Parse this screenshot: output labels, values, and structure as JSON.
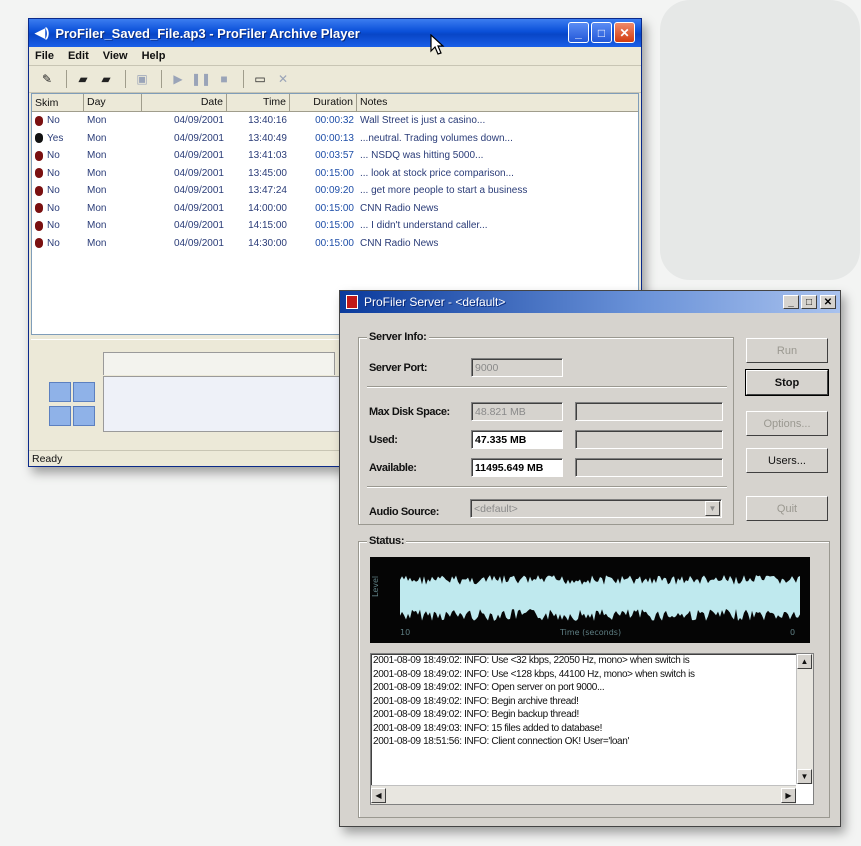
{
  "player": {
    "title": "ProFiler_Saved_File.ap3 - ProFiler Archive Player",
    "menus": [
      "File",
      "Edit",
      "View",
      "Help"
    ],
    "columns": [
      "Skim",
      "Day",
      "Date",
      "Time",
      "Duration",
      "Notes"
    ],
    "rows": [
      {
        "skim": "No",
        "day": "Mon",
        "date": "04/09/2001",
        "time": "13:40:16",
        "duration": "00:00:32",
        "notes": "Wall Street is just a casino..."
      },
      {
        "skim": "Yes",
        "day": "Mon",
        "date": "04/09/2001",
        "time": "13:40:49",
        "duration": "00:00:13",
        "notes": "...neutral.  Trading volumes down..."
      },
      {
        "skim": "No",
        "day": "Mon",
        "date": "04/09/2001",
        "time": "13:41:03",
        "duration": "00:03:57",
        "notes": "... NSDQ was hitting 5000..."
      },
      {
        "skim": "No",
        "day": "Mon",
        "date": "04/09/2001",
        "time": "13:45:00",
        "duration": "00:15:00",
        "notes": "... look at stock price comparison..."
      },
      {
        "skim": "No",
        "day": "Mon",
        "date": "04/09/2001",
        "time": "13:47:24",
        "duration": "00:09:20",
        "notes": "... get more people to start a business"
      },
      {
        "skim": "No",
        "day": "Mon",
        "date": "04/09/2001",
        "time": "14:00:00",
        "duration": "00:15:00",
        "notes": "CNN Radio News"
      },
      {
        "skim": "No",
        "day": "Mon",
        "date": "04/09/2001",
        "time": "14:15:00",
        "duration": "00:15:00",
        "notes": "... I didn't understand caller..."
      },
      {
        "skim": "No",
        "day": "Mon",
        "date": "04/09/2001",
        "time": "14:30:00",
        "duration": "00:15:00",
        "notes": "CNN Radio News"
      }
    ],
    "status": "Ready"
  },
  "server": {
    "title": "ProFiler Server - <default>",
    "server_info_label": "Server Info:",
    "server_port_label": "Server Port:",
    "server_port_value": "9000",
    "max_disk_label": "Max Disk Space:",
    "max_disk_value": "48.821 MB",
    "used_label": "Used:",
    "used_value": "47.335 MB",
    "available_label": "Available:",
    "available_value": "11495.649 MB",
    "audio_source_label": "Audio Source:",
    "audio_source_value": "<default>",
    "status_label": "Status:",
    "buttons": {
      "run": "Run",
      "stop": "Stop",
      "options": "Options...",
      "users": "Users...",
      "quit": "Quit"
    },
    "scope": {
      "ylabel": "Level",
      "xlabel": "Time (seconds)",
      "xmin": "10",
      "xmax": "0"
    },
    "log": [
      "2001-08-09 18:49:02: INFO: Use <32 kbps, 22050 Hz, mono> when switch is",
      "2001-08-09 18:49:02: INFO: Use <128 kbps, 44100 Hz, mono> when switch is",
      "2001-08-09 18:49:02: INFO: Open server on port 9000...",
      "2001-08-09 18:49:02: INFO: Begin archive thread!",
      "2001-08-09 18:49:02: INFO: Begin backup thread!",
      "2001-08-09 18:49:03: INFO: 15 files added to database!",
      "2001-08-09 18:51:56: INFO: Client connection OK! User='loan'"
    ]
  },
  "colors": {
    "xp_title": "#0a4fd8",
    "wave": "#bfe9ee",
    "list_text": "#2a3c78"
  }
}
